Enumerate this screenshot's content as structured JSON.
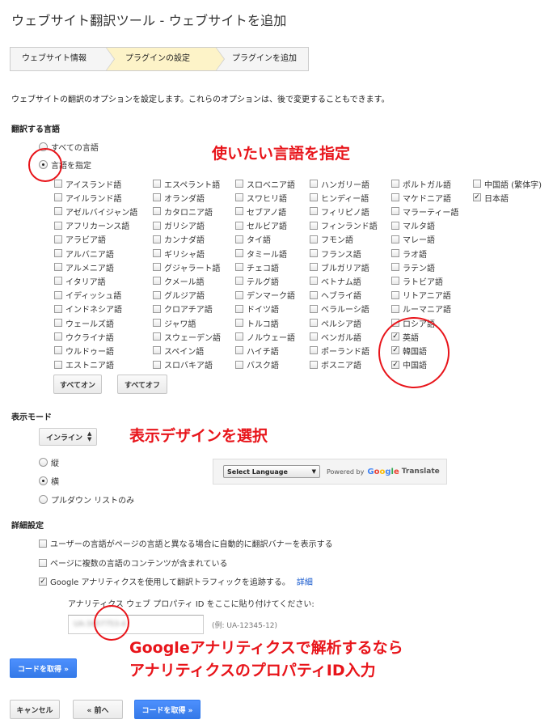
{
  "title": "ウェブサイト翻訳ツール - ウェブサイトを追加",
  "steps": [
    "ウェブサイト情報",
    "プラグインの設定",
    "プラグインを追加"
  ],
  "description": "ウェブサイトの翻訳のオプションを設定します。これらのオプションは、後で変更することもできます。",
  "languages_section": {
    "heading": "翻訳する言語",
    "all_label": "すべての言語",
    "specify_label": "言語を指定",
    "columns": [
      [
        {
          "label": "アイスランド語",
          "checked": false
        },
        {
          "label": "アイルランド語",
          "checked": false
        },
        {
          "label": "アゼルバイジャン語",
          "checked": false
        },
        {
          "label": "アフリカーンス語",
          "checked": false
        },
        {
          "label": "アラビア語",
          "checked": false
        },
        {
          "label": "アルバニア語",
          "checked": false
        },
        {
          "label": "アルメニア語",
          "checked": false
        },
        {
          "label": "イタリア語",
          "checked": false
        },
        {
          "label": "イディッシュ語",
          "checked": false
        },
        {
          "label": "インドネシア語",
          "checked": false
        },
        {
          "label": "ウェールズ語",
          "checked": false
        },
        {
          "label": "ウクライナ語",
          "checked": false
        },
        {
          "label": "ウルドゥー語",
          "checked": false
        },
        {
          "label": "エストニア語",
          "checked": false
        }
      ],
      [
        {
          "label": "エスペラント語",
          "checked": false
        },
        {
          "label": "オランダ語",
          "checked": false
        },
        {
          "label": "カタロニア語",
          "checked": false
        },
        {
          "label": "ガリシア語",
          "checked": false
        },
        {
          "label": "カンナダ語",
          "checked": false
        },
        {
          "label": "ギリシャ語",
          "checked": false
        },
        {
          "label": "グジャラート語",
          "checked": false
        },
        {
          "label": "クメール語",
          "checked": false
        },
        {
          "label": "グルジア語",
          "checked": false
        },
        {
          "label": "クロアチア語",
          "checked": false
        },
        {
          "label": "ジャワ語",
          "checked": false
        },
        {
          "label": "スウェーデン語",
          "checked": false
        },
        {
          "label": "スペイン語",
          "checked": false
        },
        {
          "label": "スロバキア語",
          "checked": false
        }
      ],
      [
        {
          "label": "スロベニア語",
          "checked": false
        },
        {
          "label": "スワヒリ語",
          "checked": false
        },
        {
          "label": "セブアノ語",
          "checked": false
        },
        {
          "label": "セルビア語",
          "checked": false
        },
        {
          "label": "タイ語",
          "checked": false
        },
        {
          "label": "タミール語",
          "checked": false
        },
        {
          "label": "チェコ語",
          "checked": false
        },
        {
          "label": "テルグ語",
          "checked": false
        },
        {
          "label": "デンマーク語",
          "checked": false
        },
        {
          "label": "ドイツ語",
          "checked": false
        },
        {
          "label": "トルコ語",
          "checked": false
        },
        {
          "label": "ノルウェー語",
          "checked": false
        },
        {
          "label": "ハイチ語",
          "checked": false
        },
        {
          "label": "バスク語",
          "checked": false
        }
      ],
      [
        {
          "label": "ハンガリー語",
          "checked": false
        },
        {
          "label": "ヒンディー語",
          "checked": false
        },
        {
          "label": "フィリピノ語",
          "checked": false
        },
        {
          "label": "フィンランド語",
          "checked": false
        },
        {
          "label": "フモン語",
          "checked": false
        },
        {
          "label": "フランス語",
          "checked": false
        },
        {
          "label": "ブルガリア語",
          "checked": false
        },
        {
          "label": "ベトナム語",
          "checked": false
        },
        {
          "label": "ヘブライ語",
          "checked": false
        },
        {
          "label": "ベラルーシ語",
          "checked": false
        },
        {
          "label": "ペルシア語",
          "checked": false
        },
        {
          "label": "ベンガル語",
          "checked": false
        },
        {
          "label": "ポーランド語",
          "checked": false
        },
        {
          "label": "ボスニア語",
          "checked": false
        }
      ],
      [
        {
          "label": "ポルトガル語",
          "checked": false
        },
        {
          "label": "マケドニア語",
          "checked": false
        },
        {
          "label": "マラーティー語",
          "checked": false
        },
        {
          "label": "マルタ語",
          "checked": false
        },
        {
          "label": "マレー語",
          "checked": false
        },
        {
          "label": "ラオ語",
          "checked": false
        },
        {
          "label": "ラテン語",
          "checked": false
        },
        {
          "label": "ラトビア語",
          "checked": false
        },
        {
          "label": "リトアニア語",
          "checked": false
        },
        {
          "label": "ルーマニア語",
          "checked": false
        },
        {
          "label": "ロシア語",
          "checked": false
        },
        {
          "label": "英語",
          "checked": true
        },
        {
          "label": "韓国語",
          "checked": true
        },
        {
          "label": "中国語",
          "checked": true
        }
      ],
      [
        {
          "label": "中国語 (繁体字)",
          "checked": false
        },
        {
          "label": "日本語",
          "checked": true
        }
      ]
    ],
    "all_on": "すべてオン",
    "all_off": "すべてオフ"
  },
  "annotations": {
    "languages": "使いたい言語を指定",
    "design": "表示デザインを選択",
    "analytics_line1": "Googleアナリティクスで解析するなら",
    "analytics_line2": "アナリティクスのプロパティID入力"
  },
  "display_mode": {
    "heading": "表示モード",
    "select_value": "インライン",
    "options": [
      "縦",
      "横",
      "プルダウン リストのみ"
    ],
    "selected": "横",
    "preview_select": "Select Language",
    "powered_by": "Powered by",
    "translate_word": "Translate"
  },
  "advanced": {
    "heading": "詳細設定",
    "options": [
      {
        "label": "ユーザーの言語がページの言語と異なる場合に自動的に翻訳バナーを表示する",
        "checked": false
      },
      {
        "label": "ページに複数の言語のコンテンツが含まれている",
        "checked": false
      },
      {
        "label": "Google アナリティクスを使用して翻訳トラフィックを追跡する。",
        "checked": true
      }
    ],
    "details_link": "詳細",
    "property_label": "アナリティクス ウェブ プロパティ ID をここに貼り付けてください:",
    "property_value": "UA-3457753-4",
    "property_example": "(例: UA-12345-12)"
  },
  "buttons": {
    "get_code": "コードを取得 »",
    "cancel": "キャンセル",
    "back": "« 前へ"
  },
  "colors": {
    "accent": "#e8141a",
    "primary_button": "#4d90fe",
    "active_step": "#fdf3c8"
  }
}
